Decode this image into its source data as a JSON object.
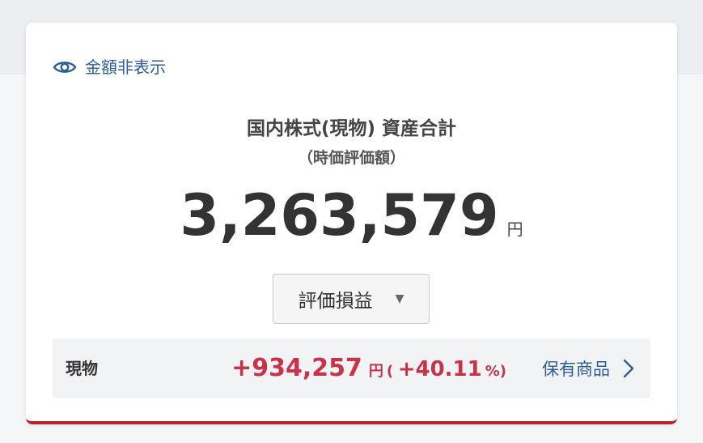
{
  "visibility_toggle": {
    "label": "金額非表示",
    "icon": "eye-icon"
  },
  "summary": {
    "title": "国内株式(現物) 資産合計",
    "subtitle": "（時価評価額）",
    "total_value": "3,263,579",
    "total_unit": "円"
  },
  "metric_dropdown": {
    "selected": "評価損益",
    "icon": "triangle-down-icon"
  },
  "holding_row": {
    "label": "現物",
    "gain_value": "+934,257",
    "gain_unit": "円",
    "paren_open": "(",
    "gain_percent": "+40.11",
    "percent_unit": "%)",
    "link_label": "保有商品",
    "link_icon": "chevron-right-icon"
  },
  "colors": {
    "accent_blue": "#2e5d95",
    "gain_red": "#c7344a",
    "card_border_red": "#b0282d"
  }
}
